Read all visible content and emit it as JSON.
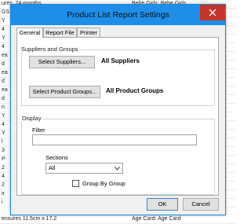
{
  "background": {
    "top_left": "ures: 24-months",
    "top_mid": "Bebe Girls: Bebe Girls",
    "bottom_left": "ensures 11.5cm x 17.2",
    "bottom_mid": "Age Card: Age Card",
    "left_snippets": [
      "GS",
      "Y",
      "4",
      "Y",
      "4",
      "ea",
      "d",
      "ea",
      "d",
      "ea",
      "d",
      "n",
      "Y",
      "4",
      "Y",
      "l",
      "3",
      "P",
      "2",
      "4",
      "2",
      "ir",
      "i"
    ],
    "right_snippets": [
      "rls",
      "ie:",
      "ie:",
      "ie:",
      "Ba",
      "Ba",
      "G",
      "Ba",
      "Ba",
      "Ba",
      "Ba",
      "Ba",
      "Ba",
      "Ba",
      "Ba",
      "ba",
      "ba",
      "Ba",
      "Ba",
      "Ba",
      "t"
    ]
  },
  "dialog": {
    "title": "Product List Report Settings",
    "close_label": "✕",
    "tabs": [
      {
        "label": "General"
      },
      {
        "label": "Report File"
      },
      {
        "label": "Printer"
      }
    ],
    "suppliers_group": {
      "title": "Suppliers and Groups",
      "select_suppliers_label": "Select Suppliers...",
      "suppliers_value": "All Suppliers",
      "select_groups_label": "Select Product Groups...",
      "groups_value": "All Product Groups"
    },
    "display_group": {
      "title": "Display",
      "filter_label": "Filter",
      "filter_value": "",
      "sections_label": "Sections",
      "sections_value": "All",
      "group_by_group_label": "Group By Group",
      "group_by_group_checked": false
    },
    "ok_label": "OK",
    "cancel_label": "Cancel"
  },
  "colors": {
    "titlebar": "#1e8ee9",
    "close": "#c7342a"
  }
}
